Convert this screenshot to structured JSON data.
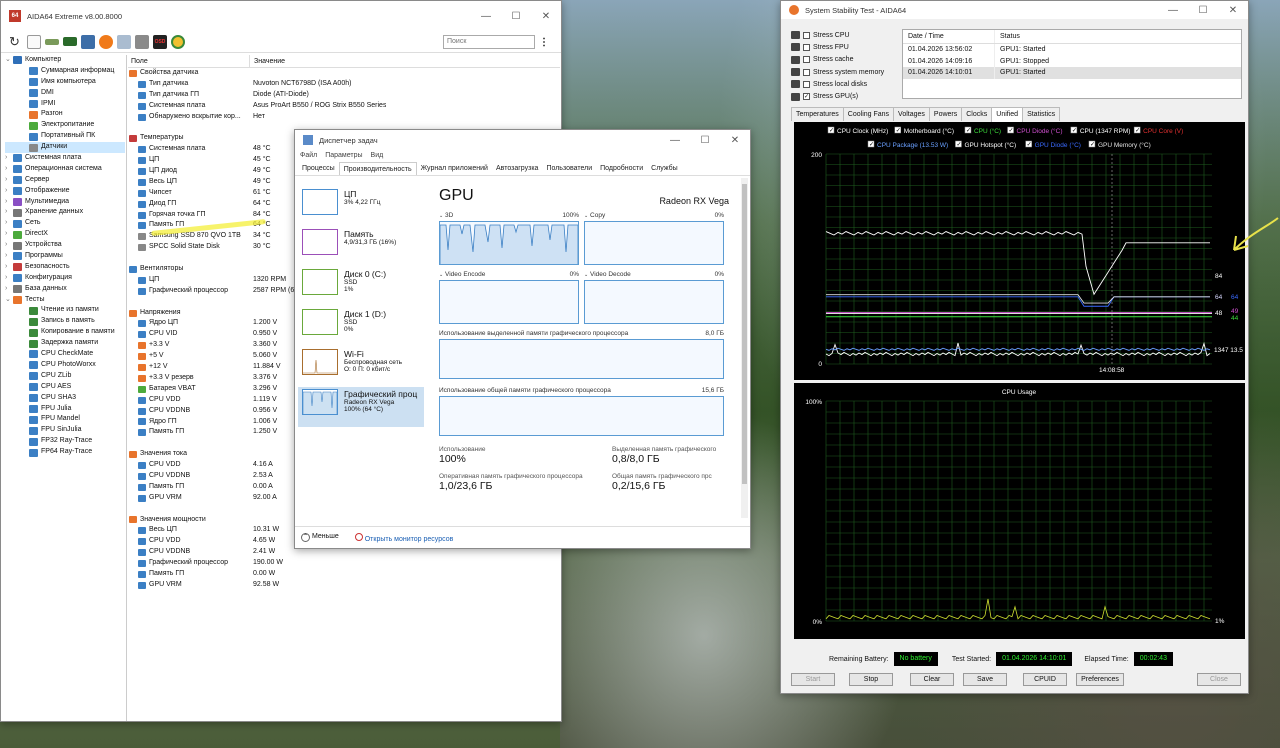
{
  "aida": {
    "title": "AIDA64 Extreme v8.00.8000",
    "search_placeholder": "Поиск",
    "col_field": "Поле",
    "col_value": "Значение",
    "tree": [
      {
        "label": "Компьютер",
        "lvl": 0,
        "exp": "⌄",
        "c": "#2f6fb8"
      },
      {
        "label": "Суммарная информац",
        "lvl": 1,
        "c": "#3b7fc4"
      },
      {
        "label": "Имя компьютера",
        "lvl": 1,
        "c": "#3b7fc4"
      },
      {
        "label": "DMI",
        "lvl": 1,
        "c": "#3b7fc4"
      },
      {
        "label": "IPMI",
        "lvl": 1,
        "c": "#3b7fc4"
      },
      {
        "label": "Разгон",
        "lvl": 1,
        "c": "#e8742c"
      },
      {
        "label": "Электропитание",
        "lvl": 1,
        "c": "#4caa3c"
      },
      {
        "label": "Портативный ПК",
        "lvl": 1,
        "c": "#3b7fc4"
      },
      {
        "label": "Датчики",
        "lvl": 1,
        "c": "#888",
        "sel": true
      },
      {
        "label": "Системная плата",
        "lvl": 0,
        "exp": "›",
        "c": "#3b7fc4"
      },
      {
        "label": "Операционная система",
        "lvl": 0,
        "exp": "›",
        "c": "#3b7fc4"
      },
      {
        "label": "Сервер",
        "lvl": 0,
        "exp": "›",
        "c": "#3b7fc4"
      },
      {
        "label": "Отображение",
        "lvl": 0,
        "exp": "›",
        "c": "#3b7fc4"
      },
      {
        "label": "Мультимедиа",
        "lvl": 0,
        "exp": "›",
        "c": "#8a4fc4"
      },
      {
        "label": "Хранение данных",
        "lvl": 0,
        "exp": "›",
        "c": "#777"
      },
      {
        "label": "Сеть",
        "lvl": 0,
        "exp": "›",
        "c": "#3b7fc4"
      },
      {
        "label": "DirectX",
        "lvl": 0,
        "exp": "›",
        "c": "#4caa3c"
      },
      {
        "label": "Устройства",
        "lvl": 0,
        "exp": "›",
        "c": "#777"
      },
      {
        "label": "Программы",
        "lvl": 0,
        "exp": "›",
        "c": "#3b7fc4"
      },
      {
        "label": "Безопасность",
        "lvl": 0,
        "exp": "›",
        "c": "#c43b3b"
      },
      {
        "label": "Конфигурация",
        "lvl": 0,
        "exp": "›",
        "c": "#3b7fc4"
      },
      {
        "label": "База данных",
        "lvl": 0,
        "exp": "›",
        "c": "#777"
      },
      {
        "label": "Тесты",
        "lvl": 0,
        "exp": "⌄",
        "c": "#e8742c"
      },
      {
        "label": "Чтение из памяти",
        "lvl": 1,
        "c": "#3b8a3b"
      },
      {
        "label": "Запись в память",
        "lvl": 1,
        "c": "#3b8a3b"
      },
      {
        "label": "Копирование в памяти",
        "lvl": 1,
        "c": "#3b8a3b"
      },
      {
        "label": "Задержка памяти",
        "lvl": 1,
        "c": "#3b8a3b"
      },
      {
        "label": "CPU CheckMate",
        "lvl": 1,
        "c": "#3b7fc4"
      },
      {
        "label": "CPU PhotoWorxx",
        "lvl": 1,
        "c": "#3b7fc4"
      },
      {
        "label": "CPU ZLib",
        "lvl": 1,
        "c": "#3b7fc4"
      },
      {
        "label": "CPU AES",
        "lvl": 1,
        "c": "#3b7fc4"
      },
      {
        "label": "CPU SHA3",
        "lvl": 1,
        "c": "#3b7fc4"
      },
      {
        "label": "FPU Julia",
        "lvl": 1,
        "c": "#3b7fc4"
      },
      {
        "label": "FPU Mandel",
        "lvl": 1,
        "c": "#3b7fc4"
      },
      {
        "label": "FPU SinJulia",
        "lvl": 1,
        "c": "#3b7fc4"
      },
      {
        "label": "FP32 Ray-Trace",
        "lvl": 1,
        "c": "#3b7fc4"
      },
      {
        "label": "FP64 Ray-Trace",
        "lvl": 1,
        "c": "#3b7fc4"
      }
    ],
    "rows": [
      {
        "s": "Свойства датчика",
        "c": "#e8742c"
      },
      {
        "f": "Тип датчика",
        "v": "Nuvoton NCT6798D  (ISA A00h)",
        "c": "#3b7fc4"
      },
      {
        "f": "Тип датчика ГП",
        "v": "Diode  (ATI-Diode)",
        "c": "#3b7fc4"
      },
      {
        "f": "Системная плата",
        "v": "Asus ProArt B550 / ROG Strix B550 Series",
        "c": "#3b7fc4"
      },
      {
        "f": "Обнаружено вскрытие кор...",
        "v": "Нет",
        "c": "#3b7fc4"
      },
      {
        "blank": true
      },
      {
        "s": "Температуры",
        "c": "#c43b3b"
      },
      {
        "f": "Системная плата",
        "v": "48 °C",
        "c": "#3b7fc4"
      },
      {
        "f": "ЦП",
        "v": "45 °C",
        "c": "#3b7fc4"
      },
      {
        "f": "ЦП диод",
        "v": "49 °C",
        "c": "#3b7fc4"
      },
      {
        "f": "Весь ЦП",
        "v": "49 °C",
        "c": "#3b7fc4"
      },
      {
        "f": "Чипсет",
        "v": "61 °C",
        "c": "#3b7fc4"
      },
      {
        "f": "Диод ГП",
        "v": "64 °C",
        "c": "#3b7fc4"
      },
      {
        "f": "Горячая точка ГП",
        "v": "84 °C",
        "c": "#3b7fc4"
      },
      {
        "f": "Память ГП",
        "v": "64 °C",
        "c": "#3b7fc4"
      },
      {
        "f": "Samsung SSD 870 QVO 1TB",
        "v": "34 °C",
        "c": "#888"
      },
      {
        "f": "SPCC Solid State Disk",
        "v": "30 °C",
        "c": "#888"
      },
      {
        "blank": true
      },
      {
        "s": "Вентиляторы",
        "c": "#3b7fc4"
      },
      {
        "f": "ЦП",
        "v": "1320 RPM",
        "c": "#3b7fc4"
      },
      {
        "f": "Графический процессор",
        "v": "2587 RPM  (6",
        "c": "#3b7fc4"
      },
      {
        "blank": true
      },
      {
        "s": "Напряжения",
        "c": "#e8742c"
      },
      {
        "f": "Ядро ЦП",
        "v": "1.200 V",
        "c": "#3b7fc4"
      },
      {
        "f": "CPU VID",
        "v": "0.950 V",
        "c": "#3b7fc4"
      },
      {
        "f": "+3.3 V",
        "v": "3.360 V",
        "c": "#e8742c"
      },
      {
        "f": "+5 V",
        "v": "5.060 V",
        "c": "#e8742c"
      },
      {
        "f": "+12 V",
        "v": "11.884 V",
        "c": "#e8742c"
      },
      {
        "f": "+3.3 V резерв",
        "v": "3.376 V",
        "c": "#e8742c"
      },
      {
        "f": "Батарея VBAT",
        "v": "3.296 V",
        "c": "#4caa3c"
      },
      {
        "f": "CPU VDD",
        "v": "1.119 V",
        "c": "#3b7fc4"
      },
      {
        "f": "CPU VDDNB",
        "v": "0.956 V",
        "c": "#3b7fc4"
      },
      {
        "f": "Ядро ГП",
        "v": "1.006 V",
        "c": "#3b7fc4"
      },
      {
        "f": "Память ГП",
        "v": "1.250 V",
        "c": "#3b7fc4"
      },
      {
        "blank": true
      },
      {
        "s": "Значения тока",
        "c": "#e8742c"
      },
      {
        "f": "CPU VDD",
        "v": "4.16 A",
        "c": "#3b7fc4"
      },
      {
        "f": "CPU VDDNB",
        "v": "2.53 A",
        "c": "#3b7fc4"
      },
      {
        "f": "Память ГП",
        "v": "0.00 A",
        "c": "#3b7fc4"
      },
      {
        "f": "GPU VRM",
        "v": "92.00 A",
        "c": "#3b7fc4"
      },
      {
        "blank": true
      },
      {
        "s": "Значения мощности",
        "c": "#e8742c"
      },
      {
        "f": "Весь ЦП",
        "v": "10.31 W",
        "c": "#3b7fc4"
      },
      {
        "f": "CPU VDD",
        "v": "4.65 W",
        "c": "#3b7fc4"
      },
      {
        "f": "CPU VDDNB",
        "v": "2.41 W",
        "c": "#3b7fc4"
      },
      {
        "f": "Графический процессор",
        "v": "190.00 W",
        "c": "#3b7fc4"
      },
      {
        "f": "Память ГП",
        "v": "0.00 W",
        "c": "#3b7fc4"
      },
      {
        "f": "GPU VRM",
        "v": "92.58 W",
        "c": "#3b7fc4"
      }
    ]
  },
  "tm": {
    "title": "Диспетчер задач",
    "menu": [
      "Файл",
      "Параметры",
      "Вид"
    ],
    "tabs": [
      "Процессы",
      "Производительность",
      "Журнал приложений",
      "Автозагрузка",
      "Пользователи",
      "Подробности",
      "Службы"
    ],
    "side": [
      {
        "t": "ЦП",
        "s1": "3% 4,22 ГГц",
        "s2": "",
        "c": "#4a8fd0"
      },
      {
        "t": "Память",
        "s1": "4,9/31,3 ГБ (16%)",
        "s2": "",
        "c": "#9b4fb8"
      },
      {
        "t": "Диск 0 (C:)",
        "s1": "SSD",
        "s2": "1%",
        "c": "#6aa83b"
      },
      {
        "t": "Диск 1 (D:)",
        "s1": "SSD",
        "s2": "0%",
        "c": "#6aa83b"
      },
      {
        "t": "Wi-Fi",
        "s1": "Беспроводная сеть",
        "s2": "О: 0  П: 0 кбит/с",
        "c": "#a86e2e"
      },
      {
        "t": "Графический проц",
        "s1": "Radeon RX Vega",
        "s2": "100% (64 °C)",
        "c": "#4a8fd0",
        "act": true
      }
    ],
    "gpu": "GPU",
    "gpu_name": "Radeon RX Vega",
    "g3d": "3D",
    "g3d_v": "100%",
    "gcopy": "Copy",
    "gcopy_v": "0%",
    "genc": "Video Encode",
    "genc_v": "0%",
    "gdec": "Video Decode",
    "gdec_v": "0%",
    "ded_label": "Использование выделенной памяти графического процессора",
    "ded_v": "8,0 ГБ",
    "sh_label": "Использование общей памяти графического процессора",
    "sh_v": "15,6 ГБ",
    "use_l": "Использование",
    "use_v": "100%",
    "dedm_l": "Выделенная память графического",
    "dedm_v": "0,8/8,0 ГБ",
    "op_l": "Оперативная память графического процессора",
    "op_v": "1,0/23,6 ГБ",
    "shm_l": "Общая память графического прс",
    "shm_v": "0,2/15,6 ГБ",
    "less": "Меньше",
    "monitor": "Открыть монитор ресурсов"
  },
  "st": {
    "title": "System Stability Test - AIDA64",
    "stress": [
      {
        "l": "Stress CPU",
        "c": false
      },
      {
        "l": "Stress FPU",
        "c": false
      },
      {
        "l": "Stress cache",
        "c": false
      },
      {
        "l": "Stress system memory",
        "c": false
      },
      {
        "l": "Stress local disks",
        "c": false
      },
      {
        "l": "Stress GPU(s)",
        "c": true
      }
    ],
    "log_h1": "Date / Time",
    "log_h2": "Status",
    "log": [
      {
        "d": "01.04.2026 13:56:02",
        "s": "GPU1: Started"
      },
      {
        "d": "01.04.2026 14:09:16",
        "s": "GPU1: Stopped"
      },
      {
        "d": "01.04.2026 14:10:01",
        "s": "GPU1: Started"
      }
    ],
    "tabs": [
      "Temperatures",
      "Cooling Fans",
      "Voltages",
      "Powers",
      "Clocks",
      "Unified",
      "Statistics"
    ],
    "legend1": [
      {
        "l": "CPU Clock (MHz)",
        "c": "#ffffff"
      },
      {
        "l": "Motherboard (°C)",
        "c": "#ffffff"
      },
      {
        "l": "CPU (°C)",
        "c": "#3cdc3c"
      },
      {
        "l": "CPU Diode (°C)",
        "c": "#d050d0"
      },
      {
        "l": "CPU (1347 RPM)",
        "c": "#ffffff"
      },
      {
        "l": "CPU Core (V)",
        "c": "#e03030"
      }
    ],
    "legend2": [
      {
        "l": "CPU Package (13.53 W)",
        "c": "#6aa0ff"
      },
      {
        "l": "GPU Hotspot (°C)",
        "c": "#ffffff"
      },
      {
        "l": "GPU Diode (°C)",
        "c": "#3a6aff"
      },
      {
        "l": "GPU Memory (°C)",
        "c": "#e0e0e0"
      }
    ],
    "y200": "200",
    "y0": "0",
    "time": "14:08:58",
    "r84": "84",
    "r64a": "64",
    "r64b": "64",
    "r48": "48",
    "r49": "49",
    "r44": "44",
    "r1347": "1347 13.5",
    "c2title": "CPU Usage",
    "c2_100": "100%",
    "c2_0": "0%",
    "c2_r": "1%",
    "battery_l": "Remaining Battery:",
    "battery_v": "No battery",
    "started_l": "Test Started:",
    "started_v": "01.04.2026 14:10:01",
    "elapsed_l": "Elapsed Time:",
    "elapsed_v": "00:02:43",
    "btns": [
      "Start",
      "Stop",
      "Clear",
      "Save",
      "CPUID",
      "Preferences",
      "Close"
    ]
  }
}
